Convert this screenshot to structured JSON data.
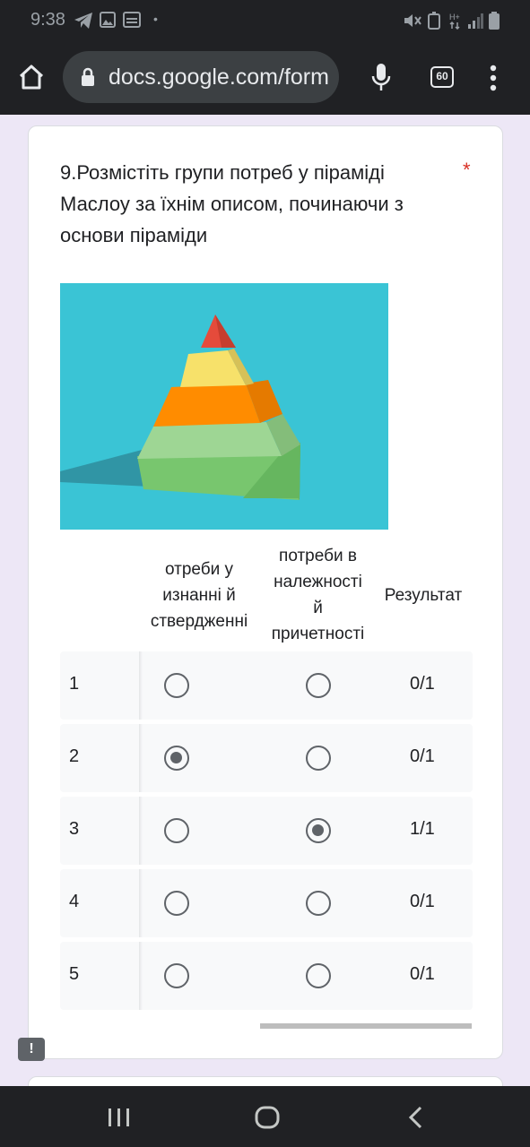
{
  "status_bar": {
    "time": "9:38"
  },
  "browser": {
    "url": "docs.google.com/form",
    "tab_count": "60",
    "icons": [
      "home-icon",
      "lock-icon",
      "mic-icon",
      "tabs-icon",
      "more-vert-icon"
    ]
  },
  "question": {
    "title": "9.Розмістіть групи потреб у піраміді Маслоу за їхнім описом, починаючи з основи піраміди",
    "required_mark": "*",
    "image": "pyramid-image",
    "columns": {
      "col1": [
        "отреби у",
        "изнанні й",
        "ствердженні"
      ],
      "col2": [
        "потреби в",
        "належності",
        "й",
        "причетності"
      ],
      "result": "Результат"
    },
    "rows": [
      {
        "label": "1",
        "selected": null,
        "score": "0/1"
      },
      {
        "label": "2",
        "selected": 0,
        "score": "0/1"
      },
      {
        "label": "3",
        "selected": 1,
        "score": "1/1"
      },
      {
        "label": "4",
        "selected": null,
        "score": "0/1"
      },
      {
        "label": "5",
        "selected": null,
        "score": "0/1"
      }
    ]
  },
  "colors": {
    "background": "#ede7f6",
    "required": "#d93025",
    "image_background": "#3ac4d5"
  }
}
